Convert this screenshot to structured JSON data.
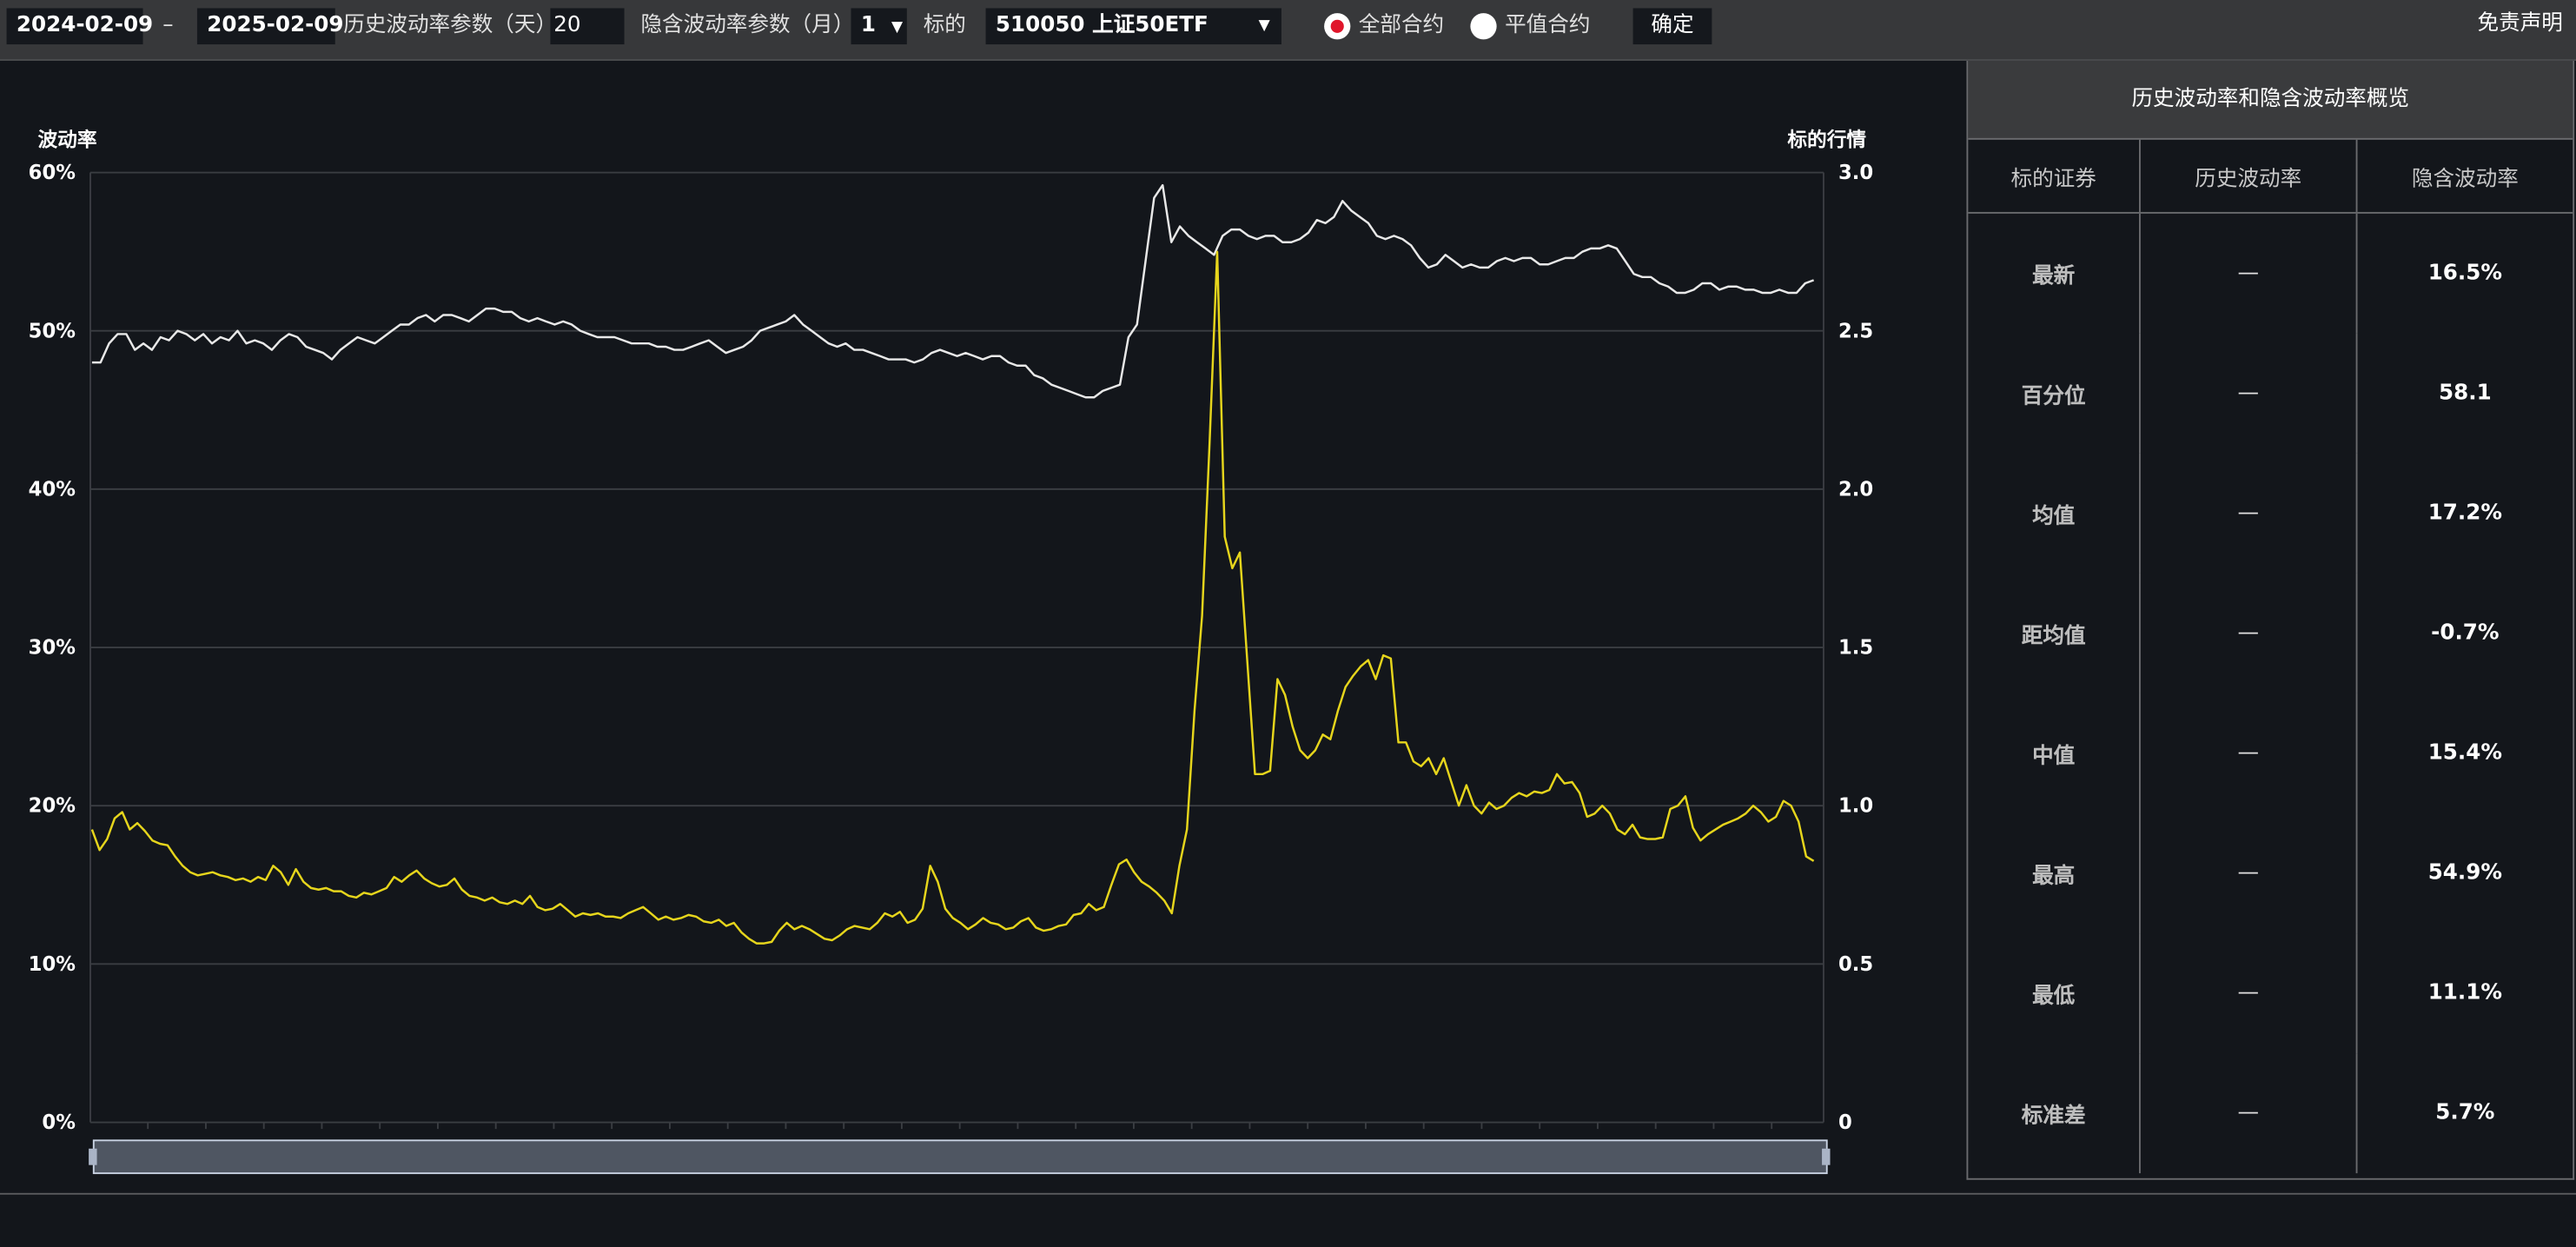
{
  "toolbar": {
    "start_date": "2024-02-09",
    "separator": "–",
    "end_date": "2025-02-09",
    "hist_param_label": "历史波动率参数（天）",
    "hist_param_value": "20",
    "implied_param_label": "隐含波动率参数（月）",
    "implied_param_value": "1",
    "dropdown_arrow": "▼",
    "underlying_label": "标的",
    "underlying_value": "510050 上证50ETF",
    "radio_all_label": "全部合约",
    "radio_atm_label": "平值合约",
    "radio_selected": "all",
    "confirm_label": "确定",
    "disclaimer_label": "免责声明"
  },
  "panel": {
    "title": "历史波动率和隐含波动率概览",
    "headers": [
      "标的证券",
      "历史波动率",
      "隐含波动率"
    ],
    "rows": [
      {
        "name": "最新",
        "hist": "—",
        "implied": "16.5%"
      },
      {
        "name": "百分位",
        "hist": "—",
        "implied": "58.1"
      },
      {
        "name": "均值",
        "hist": "—",
        "implied": "17.2%"
      },
      {
        "name": "距均值",
        "hist": "—",
        "implied": "-0.7%"
      },
      {
        "name": "中值",
        "hist": "—",
        "implied": "15.4%"
      },
      {
        "name": "最高",
        "hist": "—",
        "implied": "54.9%"
      },
      {
        "name": "最低",
        "hist": "—",
        "implied": "11.1%"
      },
      {
        "name": "标准差",
        "hist": "—",
        "implied": "5.7%"
      }
    ]
  },
  "colors": {
    "price_line": "#e8e8e8",
    "volatility_line": "#e6d51c",
    "grid": "#3a3d42",
    "toolbar_bg": "#37383a",
    "page_bg": "#13161b",
    "radio_selected": "#e0162b"
  },
  "chart_data": {
    "type": "line",
    "left_axis_label": "波动率",
    "right_axis_label": "标的行情",
    "left_ticks": [
      "0%",
      "10%",
      "20%",
      "30%",
      "40%",
      "50%",
      "60%"
    ],
    "right_ticks": [
      "0",
      "0.5",
      "1.0",
      "1.5",
      "2.0",
      "2.5",
      "3.0"
    ],
    "ylim_left": [
      0,
      60
    ],
    "ylim_right": [
      0,
      3.0
    ],
    "grid": true,
    "series": [
      {
        "axis": "right",
        "values": [
          2.4,
          2.4,
          2.46,
          2.49,
          2.49,
          2.44,
          2.46,
          2.44,
          2.48,
          2.47,
          2.5,
          2.49,
          2.47,
          2.49,
          2.46,
          2.48,
          2.47,
          2.5,
          2.46,
          2.47,
          2.46,
          2.44,
          2.47,
          2.49,
          2.48,
          2.45,
          2.44,
          2.43,
          2.41,
          2.44,
          2.46,
          2.48,
          2.47,
          2.46,
          2.48,
          2.5,
          2.52,
          2.52,
          2.54,
          2.55,
          2.53,
          2.55,
          2.55,
          2.54,
          2.53,
          2.55,
          2.57,
          2.57,
          2.56,
          2.56,
          2.54,
          2.53,
          2.54,
          2.53,
          2.52,
          2.53,
          2.52,
          2.5,
          2.49,
          2.48,
          2.48,
          2.48,
          2.47,
          2.46,
          2.46,
          2.46,
          2.45,
          2.45,
          2.44,
          2.44,
          2.45,
          2.46,
          2.47,
          2.45,
          2.43,
          2.44,
          2.45,
          2.47,
          2.5,
          2.51,
          2.52,
          2.53,
          2.55,
          2.52,
          2.5,
          2.48,
          2.46,
          2.45,
          2.46,
          2.44,
          2.44,
          2.43,
          2.42,
          2.41,
          2.41,
          2.41,
          2.4,
          2.41,
          2.43,
          2.44,
          2.43,
          2.42,
          2.43,
          2.42,
          2.41,
          2.42,
          2.42,
          2.4,
          2.39,
          2.39,
          2.36,
          2.35,
          2.33,
          2.32,
          2.31,
          2.3,
          2.29,
          2.29,
          2.31,
          2.32,
          2.33,
          2.48,
          2.52,
          2.72,
          2.92,
          2.96,
          2.78,
          2.83,
          2.8,
          2.78,
          2.76,
          2.74,
          2.8,
          2.82,
          2.82,
          2.8,
          2.79,
          2.8,
          2.8,
          2.78,
          2.78,
          2.79,
          2.81,
          2.85,
          2.84,
          2.86,
          2.91,
          2.88,
          2.86,
          2.84,
          2.8,
          2.79,
          2.8,
          2.79,
          2.77,
          2.73,
          2.7,
          2.71,
          2.74,
          2.72,
          2.7,
          2.71,
          2.7,
          2.7,
          2.72,
          2.73,
          2.72,
          2.73,
          2.73,
          2.71,
          2.71,
          2.72,
          2.73,
          2.73,
          2.75,
          2.76,
          2.76,
          2.77,
          2.76,
          2.72,
          2.68,
          2.67,
          2.67,
          2.65,
          2.64,
          2.62,
          2.62,
          2.63,
          2.65,
          2.65,
          2.63,
          2.64,
          2.64,
          2.63,
          2.63,
          2.62,
          2.62,
          2.63,
          2.62,
          2.62,
          2.65,
          2.66
        ]
      },
      {
        "axis": "left",
        "values": [
          18.5,
          17.2,
          17.9,
          19.2,
          19.6,
          18.5,
          18.9,
          18.4,
          17.8,
          17.6,
          17.5,
          16.8,
          16.2,
          15.8,
          15.6,
          15.7,
          15.8,
          15.6,
          15.5,
          15.3,
          15.4,
          15.2,
          15.5,
          15.3,
          16.2,
          15.8,
          15.0,
          16.0,
          15.2,
          14.8,
          14.7,
          14.8,
          14.6,
          14.6,
          14.3,
          14.2,
          14.5,
          14.4,
          14.6,
          14.8,
          15.5,
          15.2,
          15.6,
          15.9,
          15.4,
          15.1,
          14.9,
          15.0,
          15.4,
          14.7,
          14.3,
          14.2,
          14.0,
          14.2,
          13.9,
          13.8,
          14.0,
          13.8,
          14.3,
          13.6,
          13.4,
          13.5,
          13.8,
          13.4,
          13.0,
          13.2,
          13.1,
          13.2,
          13.0,
          13.0,
          12.9,
          13.2,
          13.4,
          13.6,
          13.2,
          12.8,
          13.0,
          12.8,
          12.9,
          13.1,
          13.0,
          12.7,
          12.6,
          12.8,
          12.4,
          12.6,
          12.0,
          11.6,
          11.3,
          11.3,
          11.4,
          12.1,
          12.6,
          12.2,
          12.4,
          12.2,
          11.9,
          11.6,
          11.5,
          11.8,
          12.2,
          12.4,
          12.3,
          12.2,
          12.6,
          13.2,
          13.0,
          13.3,
          12.6,
          12.8,
          13.5,
          16.2,
          15.2,
          13.5,
          12.9,
          12.6,
          12.2,
          12.5,
          12.9,
          12.6,
          12.5,
          12.2,
          12.3,
          12.7,
          12.9,
          12.3,
          12.1,
          12.2,
          12.4,
          12.5,
          13.1,
          13.2,
          13.8,
          13.4,
          13.6,
          15.0,
          16.3,
          16.6,
          15.8,
          15.2,
          14.9,
          14.5,
          14.0,
          13.2,
          16.2,
          18.5,
          26.0,
          32.0,
          43.0,
          55.0,
          37.0,
          35.0,
          36.0,
          29.0,
          22.0,
          22.0,
          22.2,
          28.0,
          27.0,
          25.0,
          23.5,
          23.0,
          23.5,
          24.5,
          24.2,
          26.0,
          27.5,
          28.2,
          28.8,
          29.2,
          28.0,
          29.5,
          29.3,
          24.0,
          24.0,
          22.8,
          22.5,
          23.0,
          22.0,
          23.0,
          21.5,
          20.0,
          21.3,
          20.0,
          19.5,
          20.2,
          19.8,
          20.0,
          20.5,
          20.8,
          20.6,
          20.9,
          20.8,
          21.0,
          22.0,
          21.4,
          21.5,
          20.8,
          19.3,
          19.5,
          20.0,
          19.5,
          18.5,
          18.2,
          18.8,
          18.0,
          17.9,
          17.9,
          18.0,
          19.8,
          20.0,
          20.6,
          18.6,
          17.8,
          18.2,
          18.5,
          18.8,
          19.0,
          19.2,
          19.5,
          20.0,
          19.6,
          19.0,
          19.3,
          20.3,
          20.0,
          19.0,
          16.8,
          16.5
        ]
      }
    ]
  }
}
